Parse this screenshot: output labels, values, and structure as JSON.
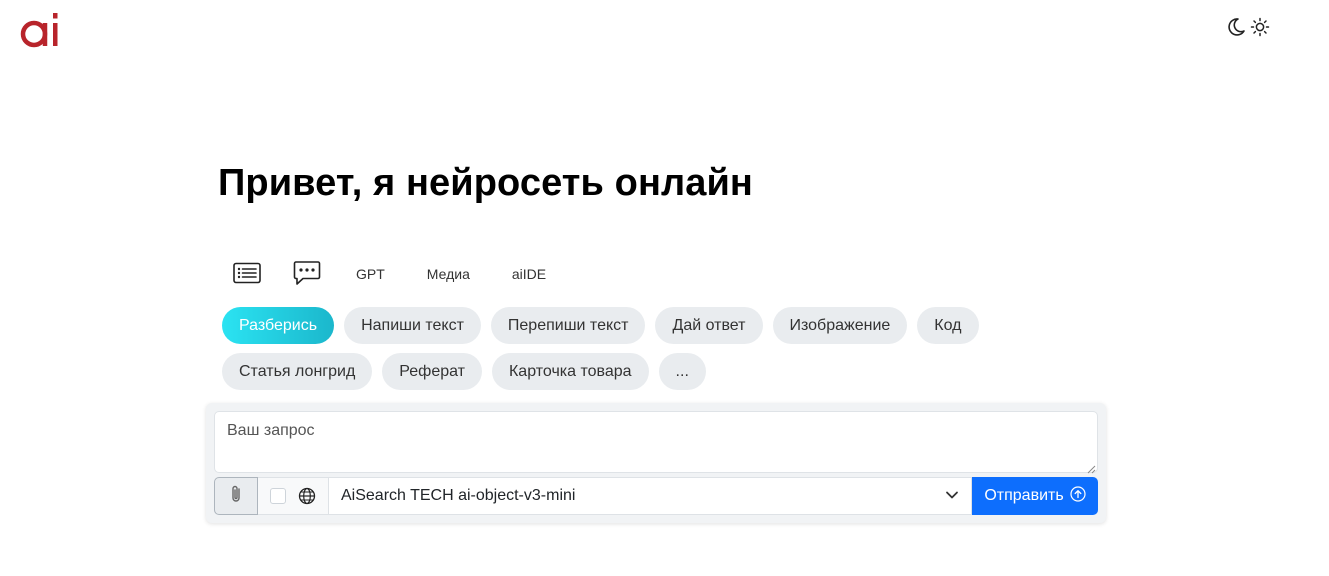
{
  "header": {
    "logo_text": "ai",
    "brand_color": "#b8242b",
    "theme_icons": [
      "moon-icon",
      "sun-icon"
    ]
  },
  "main": {
    "title": "Привет, я нейросеть онлайн"
  },
  "mode_tabs": {
    "icons": [
      "list-icon",
      "chat-icon"
    ],
    "gpt": "GPT",
    "media": "Медиа",
    "ide": "aiIDE"
  },
  "chips": {
    "row1": [
      "Разберись",
      "Напиши текст",
      "Перепиши текст",
      "Дай ответ",
      "Изображение",
      "Код"
    ],
    "row2": [
      "Статья лонгрид",
      "Реферат",
      "Карточка товара",
      "..."
    ],
    "active": "Разберись",
    "active_gradient": [
      "#2be3f2",
      "#1bb7cc"
    ]
  },
  "input": {
    "placeholder": "Ваш запрос",
    "attach_icon": "paperclip-icon",
    "web_search_icon": "globe-icon",
    "model": "AiSearch TECH ai-object-v3-mini",
    "send_label": "Отправить",
    "send_color": "#0d6efd"
  }
}
